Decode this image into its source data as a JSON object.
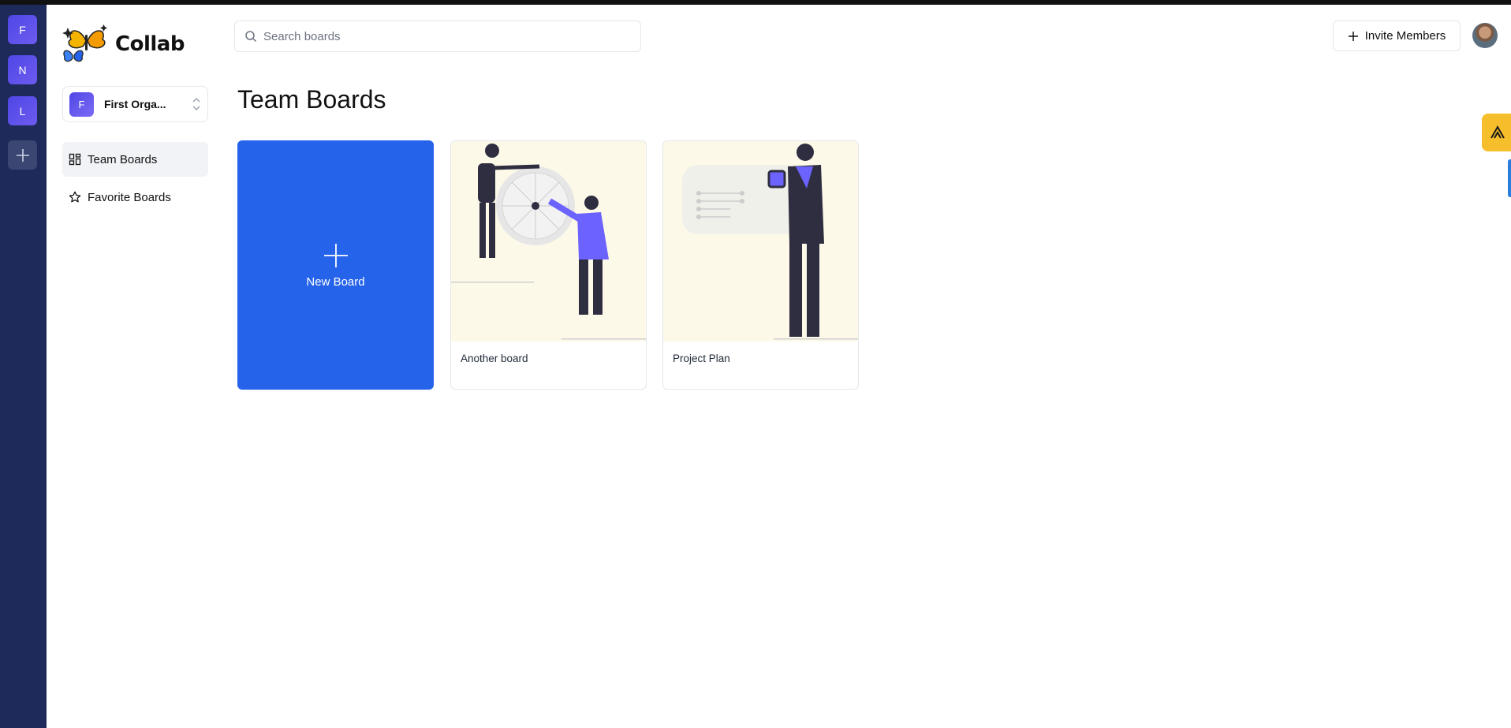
{
  "org_rail": {
    "orgs": [
      {
        "initial": "F"
      },
      {
        "initial": "N"
      },
      {
        "initial": "L"
      }
    ]
  },
  "sidebar": {
    "logo_text": "Collab",
    "org_switcher": {
      "initial": "F",
      "name": "First Orga..."
    },
    "nav": [
      {
        "label": "Team Boards",
        "icon": "dashboard-icon",
        "active": true
      },
      {
        "label": "Favorite Boards",
        "icon": "star-icon",
        "active": false
      }
    ]
  },
  "header": {
    "search_placeholder": "Search boards",
    "invite_label": "Invite Members"
  },
  "main": {
    "title": "Team Boards",
    "new_board_label": "New Board",
    "boards": [
      {
        "title": "Another board"
      },
      {
        "title": "Project Plan"
      }
    ]
  },
  "colors": {
    "rail_bg": "#1e2a5a",
    "primary": "#2563eb",
    "board_image_bg": "#fdf9e9",
    "widget_yellow": "#f6be2a"
  }
}
